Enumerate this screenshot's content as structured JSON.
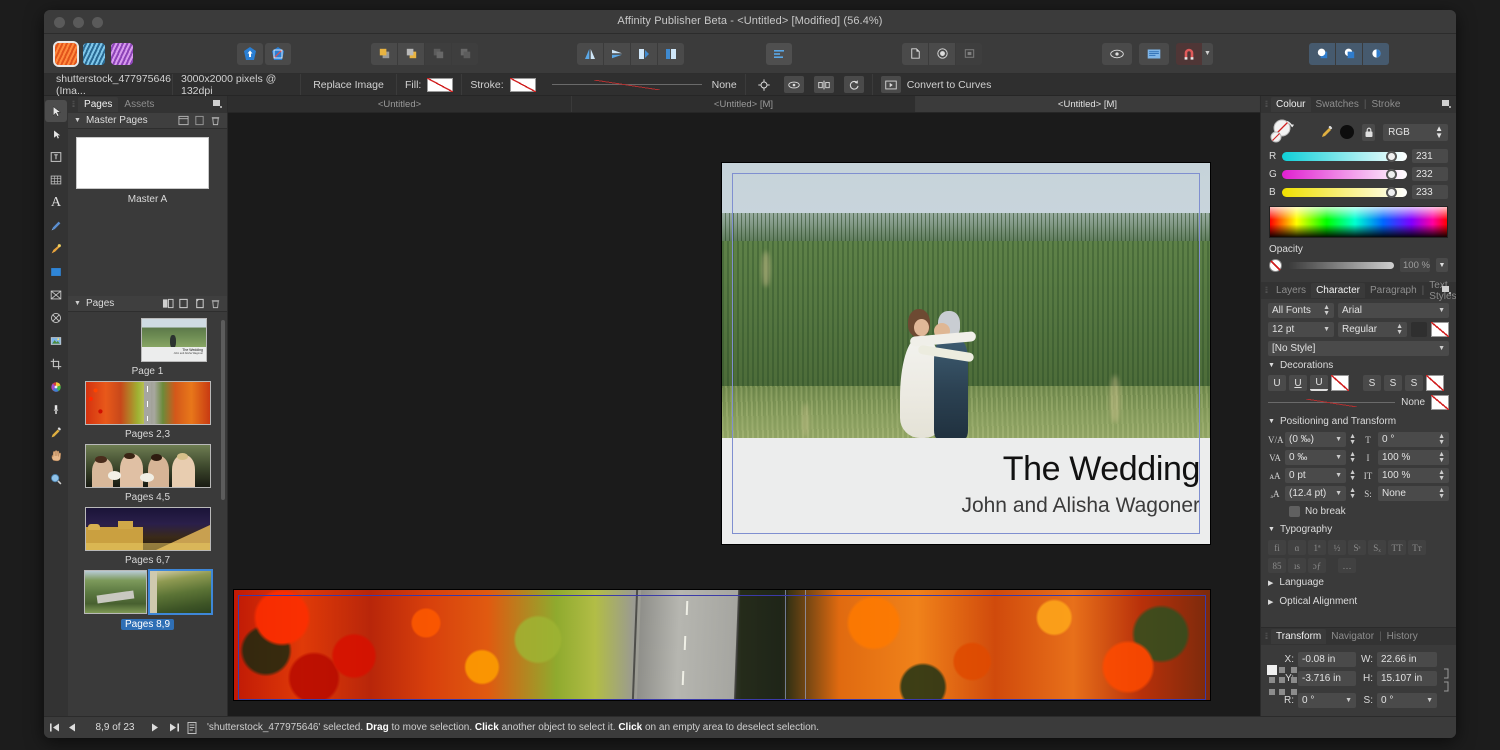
{
  "window": {
    "title": "Affinity Publisher Beta - <Untitled> [Modified] (56.4%)"
  },
  "toolbar": {
    "persona_icons": [
      "publisher-persona",
      "designer-persona",
      "photo-persona"
    ],
    "groups": [
      {
        "name": "share",
        "buttons": [
          "share-icon",
          "colour-picker-icon"
        ]
      },
      {
        "name": "arrange",
        "buttons": [
          "move-to-front-icon",
          "move-forward-icon",
          "move-backward-icon",
          "move-to-back-icon"
        ]
      },
      {
        "name": "align-flip",
        "buttons": [
          "flip-horizontal-icon",
          "flip-vertical-icon",
          "rotate-left-icon",
          "rotate-right-icon"
        ]
      },
      {
        "name": "text-align",
        "buttons": [
          "align-text-icon"
        ]
      },
      {
        "name": "shapes",
        "buttons": [
          "document-icon",
          "circle-icon",
          "frame-icon"
        ]
      },
      {
        "name": "view",
        "buttons": [
          "preview-icon",
          "text-frame-icon",
          "snapping-icon"
        ]
      },
      {
        "name": "boolean",
        "buttons": [
          "add-icon",
          "subtract-icon",
          "intersect-icon"
        ]
      }
    ]
  },
  "context_bar": {
    "object_name": "shutterstock_477975646 (Ima...",
    "dimensions": "3000x2000 pixels @ 132dpi",
    "replace_image_label": "Replace Image",
    "fill_label": "Fill:",
    "stroke_label": "Stroke:",
    "stroke_style_label": "None",
    "convert_label": "Convert to Curves",
    "icon_buttons": [
      "crosshair-icon",
      "eye-icon",
      "mirror-icon",
      "refresh-icon",
      "curves-icon"
    ]
  },
  "tools": [
    {
      "name": "move-tool",
      "glyph": "arrow",
      "selected": true
    },
    {
      "name": "node-tool",
      "glyph": "node",
      "selected": false
    },
    {
      "name": "text-frame-tool",
      "glyph": "frametext",
      "selected": false
    },
    {
      "name": "table-tool",
      "glyph": "table",
      "selected": false
    },
    {
      "name": "artistic-text-tool",
      "glyph": "A",
      "selected": false
    },
    {
      "name": "pen-tool",
      "glyph": "pen",
      "selected": false
    },
    {
      "name": "pencil-tool",
      "glyph": "pencil",
      "selected": false
    },
    {
      "name": "rectangle-tool",
      "glyph": "rect",
      "selected": false
    },
    {
      "name": "picture-frame-tool",
      "glyph": "picframe",
      "selected": false
    },
    {
      "name": "ellipse-tool",
      "glyph": "ellipse",
      "selected": false
    },
    {
      "name": "place-image-tool",
      "glyph": "image",
      "selected": false
    },
    {
      "name": "crop-tool",
      "glyph": "crop",
      "selected": false
    },
    {
      "name": "fill-tool",
      "glyph": "palette",
      "selected": false
    },
    {
      "name": "transparency-tool",
      "glyph": "transparency",
      "selected": false
    },
    {
      "name": "colour-picker-tool",
      "glyph": "dropper",
      "selected": false
    },
    {
      "name": "view-tool",
      "glyph": "hand",
      "selected": false
    },
    {
      "name": "zoom-tool",
      "glyph": "zoom",
      "selected": false
    }
  ],
  "pages_panel": {
    "tabs": [
      {
        "label": "Pages",
        "active": true
      },
      {
        "label": "Assets",
        "active": false
      }
    ],
    "master_section": {
      "title": "Master Pages",
      "items": [
        {
          "label": "Master A"
        }
      ]
    },
    "pages_section": {
      "title": "Pages",
      "items": [
        {
          "label": "Page 1",
          "kind": "single",
          "selected": false
        },
        {
          "label": "Pages 2,3",
          "kind": "spread",
          "selected": false
        },
        {
          "label": "Pages 4,5",
          "kind": "spread",
          "selected": false
        },
        {
          "label": "Pages 6,7",
          "kind": "spread",
          "selected": false
        },
        {
          "label": "Pages 8,9",
          "kind": "spread",
          "selected": true
        }
      ]
    }
  },
  "document_tabs": [
    {
      "label": "<Untitled>",
      "active": false
    },
    {
      "label": "<Untitled> [M]",
      "active": false
    },
    {
      "label": "<Untitled> [M]",
      "active": true
    }
  ],
  "canvas": {
    "page1": {
      "title": "The Wedding",
      "subtitle": "John and Alisha Wagoner"
    }
  },
  "colour_panel": {
    "tabs": [
      {
        "label": "Colour",
        "active": true
      },
      {
        "label": "Swatches",
        "active": false
      },
      {
        "label": "Stroke",
        "active": false
      }
    ],
    "mode": "RGB",
    "channels": [
      {
        "label": "R",
        "value": "231"
      },
      {
        "label": "G",
        "value": "232"
      },
      {
        "label": "B",
        "value": "233"
      }
    ],
    "opacity_label": "Opacity",
    "opacity_value": "100 %"
  },
  "character_panel": {
    "tabs": [
      {
        "label": "Layers",
        "active": false
      },
      {
        "label": "Character",
        "active": true
      },
      {
        "label": "Paragraph",
        "active": false
      },
      {
        "label": "Text Styles",
        "active": false
      }
    ],
    "font_filter": "All Fonts",
    "font_family": "Arial",
    "font_size": "12 pt",
    "font_style": "Regular",
    "text_style": "[No Style]",
    "decorations": {
      "title": "Decorations",
      "buttons": [
        "underline",
        "underline-double",
        "underline-thick",
        "underline-colour",
        "strikethrough",
        "strikethrough-2",
        "strikethrough-3",
        "strikethrough-colour"
      ],
      "none_label": "None"
    },
    "positioning": {
      "title": "Positioning and Transform",
      "left": [
        {
          "icon": "tracking-icon",
          "value": "(0 ‰)"
        },
        {
          "icon": "kerning-icon",
          "value": "0 ‰"
        },
        {
          "icon": "baseline-icon",
          "value": "0 pt"
        },
        {
          "icon": "leading-icon",
          "value": "(12.4 pt)"
        }
      ],
      "right": [
        {
          "icon": "shear-icon",
          "value": "0 °"
        },
        {
          "icon": "vertical-scale-icon",
          "value": "100 %"
        },
        {
          "icon": "horizontal-scale-icon",
          "value": "100 %"
        },
        {
          "icon": "position-icon",
          "value": "None"
        }
      ],
      "no_break_label": "No break"
    },
    "typography": {
      "title": "Typography",
      "row1": [
        "fi",
        "ɑ",
        "1ª",
        "½",
        "Sˢ",
        "Sₓ",
        "TT",
        "Tᴛ"
      ],
      "row2": [
        "85",
        "ıѕ",
        "ɔƒ",
        "…"
      ]
    },
    "language_label": "Language",
    "optical_alignment_label": "Optical Alignment"
  },
  "transform_panel": {
    "tabs": [
      {
        "label": "Transform",
        "active": true
      },
      {
        "label": "Navigator",
        "active": false
      },
      {
        "label": "History",
        "active": false
      }
    ],
    "fields": [
      {
        "label": "X:",
        "value": "-0.08 in"
      },
      {
        "label": "W:",
        "value": "22.66 in"
      },
      {
        "label": "Y:",
        "value": "-3.716 in"
      },
      {
        "label": "H:",
        "value": "15.107 in"
      },
      {
        "label": "R:",
        "value": "0 °"
      },
      {
        "label": "S:",
        "value": "0 °"
      }
    ]
  },
  "status_bar": {
    "page_indicator": "8,9 of 23",
    "message_prefix": "'shutterstock_477975646' selected. ",
    "message_bold1": "Drag",
    "message_mid1": " to move selection. ",
    "message_bold2": "Click",
    "message_mid2": " another object to select it. ",
    "message_bold3": "Click",
    "message_suffix": " on an empty area to deselect selection."
  },
  "colors": {
    "accent": "#3e87d8",
    "panel_bg": "#3a3a3a",
    "toolbar_bg": "#3b3b3b",
    "canvas_bg": "#1b1b1b"
  }
}
